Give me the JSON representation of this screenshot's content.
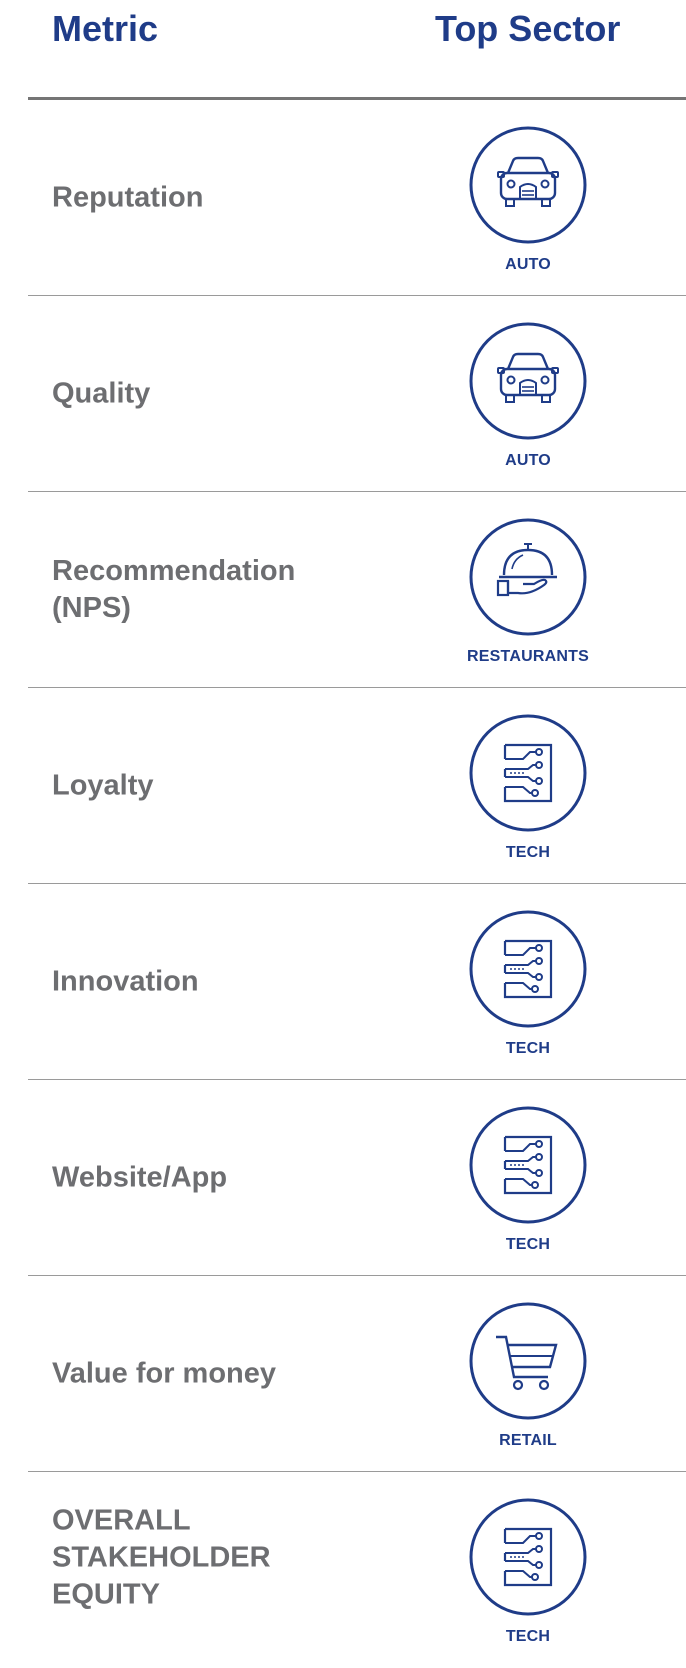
{
  "header": {
    "metric_label": "Metric",
    "sector_label": "Top Sector"
  },
  "colors": {
    "accent": "#1f3c88",
    "metric_text": "#6d6e71",
    "divider": "#9a9a9a"
  },
  "rows": [
    {
      "metric": "Reputation",
      "sector": "AUTO",
      "icon": "car-icon"
    },
    {
      "metric": "Quality",
      "sector": "AUTO",
      "icon": "car-icon"
    },
    {
      "metric": "Recommendation\n(NPS)",
      "sector": "RESTAURANTS",
      "icon": "cloche-icon"
    },
    {
      "metric": "Loyalty",
      "sector": "TECH",
      "icon": "circuit-icon"
    },
    {
      "metric": "Innovation",
      "sector": "TECH",
      "icon": "circuit-icon"
    },
    {
      "metric": "Website/App",
      "sector": "TECH",
      "icon": "circuit-icon"
    },
    {
      "metric": "Value for money",
      "sector": "RETAIL",
      "icon": "cart-icon"
    },
    {
      "metric": "OVERALL\nSTAKEHOLDER\nEQUITY",
      "sector": "TECH",
      "icon": "circuit-icon"
    }
  ]
}
